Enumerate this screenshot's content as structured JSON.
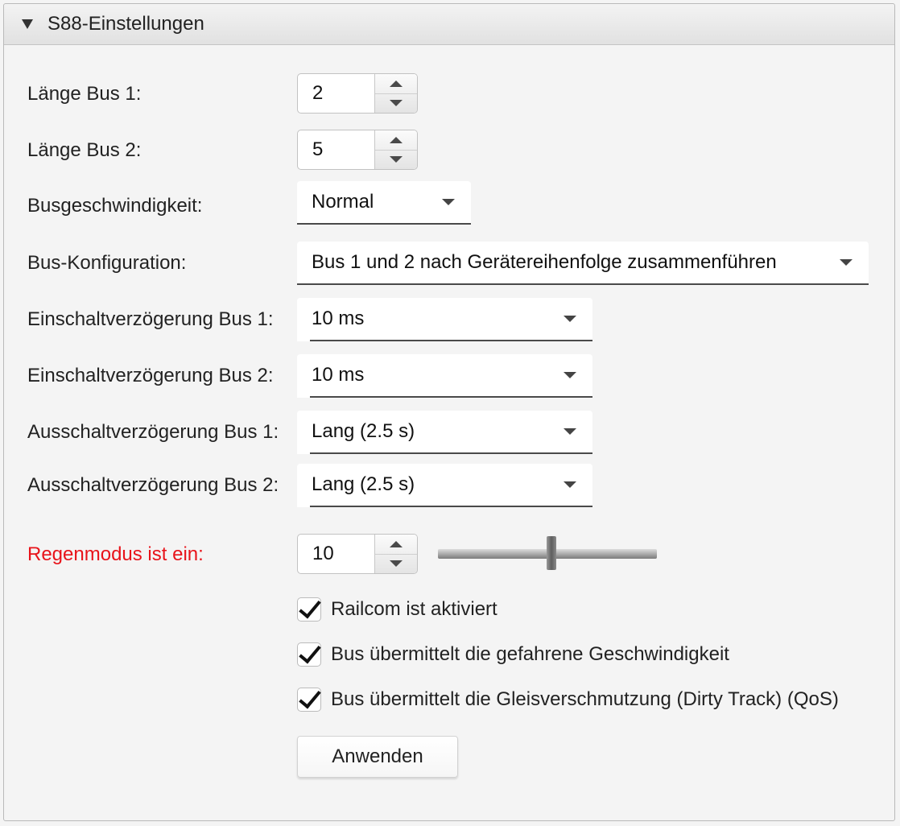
{
  "panel": {
    "title": "S88-Einstellungen"
  },
  "form": {
    "bus1_length": {
      "label": "Länge Bus 1:",
      "value": "2"
    },
    "bus2_length": {
      "label": "Länge Bus 2:",
      "value": "5"
    },
    "bus_speed": {
      "label": "Busgeschwindigkeit:",
      "value": "Normal"
    },
    "bus_config": {
      "label": "Bus-Konfiguration:",
      "value": "Bus 1 und 2 nach Gerätereihenfolge zusammenführen"
    },
    "on_delay_bus1": {
      "label": "Einschaltverzögerung Bus 1:",
      "value": "10 ms"
    },
    "on_delay_bus2": {
      "label": "Einschaltverzögerung Bus 2:",
      "value": "10 ms"
    },
    "off_delay_bus1": {
      "label": "Ausschaltverzögerung Bus 1:",
      "value": "Lang (2.5 s)"
    },
    "off_delay_bus2": {
      "label": "Ausschaltverzögerung Bus 2:",
      "value": "Lang (2.5 s)"
    },
    "rain_mode": {
      "label": "Regenmodus ist ein:",
      "value": "10",
      "label_color": "#e8131a",
      "slider_fraction": 0.52
    },
    "checkboxes": [
      {
        "label": "Railcom ist aktiviert",
        "checked": true
      },
      {
        "label": "Bus übermittelt die gefahrene Geschwindigkeit",
        "checked": true
      },
      {
        "label": "Bus übermittelt die Gleisverschmutzung (Dirty Track) (QoS)",
        "checked": true
      }
    ],
    "apply_label": "Anwenden"
  }
}
